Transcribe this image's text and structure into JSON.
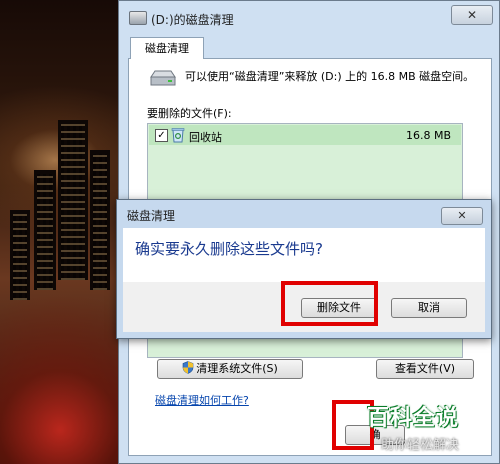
{
  "main_window": {
    "title": "(D:)的磁盘清理",
    "close_symbol": "✕",
    "tab_label": "磁盘清理",
    "description": "可以使用“磁盘清理”来释放 (D:) 上的 16.8 MB 磁盘空间。",
    "files_label": "要删除的文件(F):",
    "files": [
      {
        "checked": true,
        "check_symbol": "✓",
        "name": "回收站",
        "size": "16.8 MB",
        "icon": "recycle-bin-icon"
      }
    ],
    "clean_system_button": "清理系统文件(S)",
    "view_files_button": "查看文件(V)",
    "help_link": "磁盘清理如何工作?",
    "ok_button_partial": "确"
  },
  "dialog": {
    "title": "磁盘清理",
    "close_symbol": "✕",
    "question": "确实要永久删除这些文件吗?",
    "delete_button": "删除文件",
    "cancel_button": "取消"
  },
  "watermark": {
    "logo": "百科全说",
    "slogan": "助你轻松解决"
  },
  "colors": {
    "highlight_box": "#e00000",
    "list_background": "#d8f0d8",
    "link": "#0645ad"
  }
}
